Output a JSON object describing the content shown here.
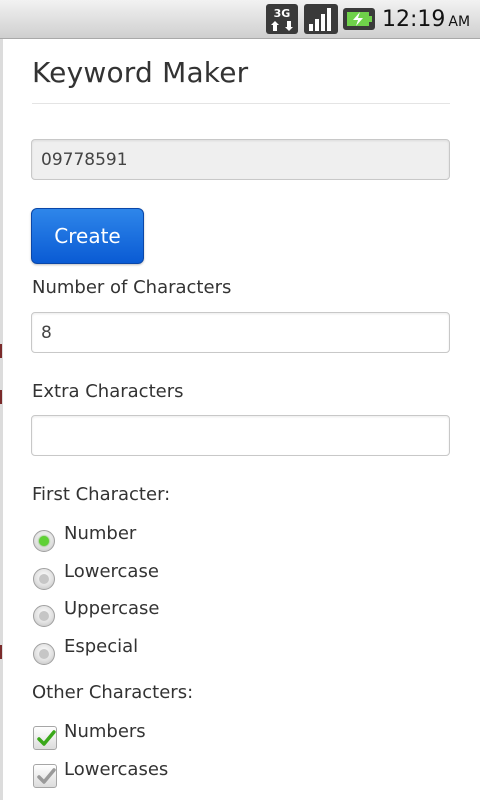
{
  "status_bar": {
    "network": "3G",
    "time": "12:19",
    "ampm": "AM",
    "icons": [
      "3g-data-icon",
      "signal-icon",
      "battery-charging-icon"
    ]
  },
  "app": {
    "title": "Keyword Maker",
    "generated_value": "09778591",
    "create_label": "Create",
    "num_chars_label": "Number of Characters",
    "num_chars_value": "8",
    "extra_chars_label": "Extra Characters",
    "extra_chars_value": "",
    "first_char_label": "First Character:",
    "first_char_options": [
      {
        "label": "Number",
        "selected": true
      },
      {
        "label": "Lowercase",
        "selected": false
      },
      {
        "label": "Uppercase",
        "selected": false
      },
      {
        "label": "Especial",
        "selected": false
      }
    ],
    "other_chars_label": "Other Characters:",
    "other_chars_options": [
      {
        "label": "Numbers",
        "checked": true
      },
      {
        "label": "Lowercases",
        "checked": true
      }
    ]
  },
  "colors": {
    "button": "#0a5bd4",
    "radio_selected": "#5fd135",
    "check_green": "#3aa81a",
    "check_gray": "#9a9a9a"
  }
}
